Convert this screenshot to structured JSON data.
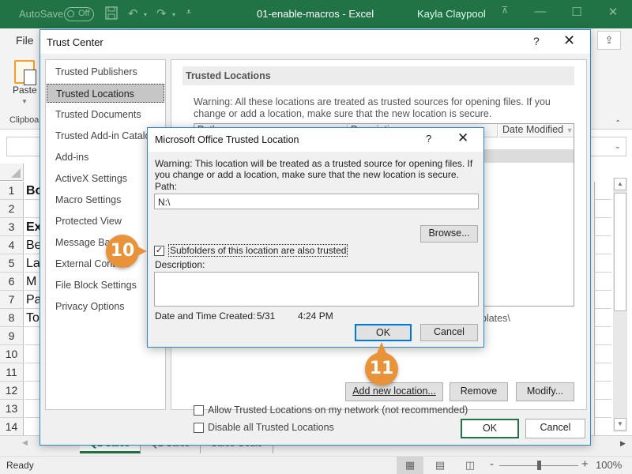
{
  "excel": {
    "autosave_label": "AutoSave",
    "autosave_state": "Off",
    "doc_title": "01-enable-macros  -  Excel",
    "user_name": "Kayla Claypool",
    "file_tab": "File",
    "paste_label": "Paste",
    "clipboard_group": "Clipboa",
    "rows": [
      {
        "num": "1",
        "a": "Bo",
        "bold": true
      },
      {
        "num": "2",
        "a": "",
        "bold": false
      },
      {
        "num": "3",
        "a": "Ex",
        "bold": true
      },
      {
        "num": "4",
        "a": "Be",
        "bold": false
      },
      {
        "num": "5",
        "a": "La",
        "bold": false
      },
      {
        "num": "6",
        "a": "M",
        "bold": false
      },
      {
        "num": "7",
        "a": "Pa",
        "bold": false
      },
      {
        "num": "8",
        "a": "To",
        "bold": false
      },
      {
        "num": "9",
        "a": "",
        "bold": false
      },
      {
        "num": "10",
        "a": "",
        "bold": false
      },
      {
        "num": "11",
        "a": "",
        "bold": false
      },
      {
        "num": "12",
        "a": "",
        "bold": false
      },
      {
        "num": "13",
        "a": "",
        "bold": false
      },
      {
        "num": "14",
        "a": "",
        "bold": false
      }
    ],
    "sheet_tabs": [
      "Q1 Sales",
      "Q2 Sales",
      "Sales Goals"
    ],
    "active_sheet": "Q1 Sales",
    "status": "Ready",
    "zoom_level": "100%"
  },
  "trust_center": {
    "title": "Trust Center",
    "help": "?",
    "nav_items": [
      "Trusted Publishers",
      "Trusted Locations",
      "Trusted Documents",
      "Trusted Add-in Catalogs",
      "Add-ins",
      "ActiveX Settings",
      "Macro Settings",
      "Protected View",
      "Message Bar",
      "External Content",
      "File Block Settings",
      "Privacy Options"
    ],
    "selected_nav": "Trusted Locations",
    "section_title": "Trusted Locations",
    "warning": "Warning: All these locations are treated as trusted sources for opening files.  If you change or add a location, make sure that the new location is secure.",
    "list_columns": [
      "Path",
      "Description",
      "Date Modified"
    ],
    "path_fragment": "plates\\",
    "buttons": {
      "add": "Add new location...",
      "remove": "Remove",
      "modify": "Modify..."
    },
    "allow_network": {
      "label": "Allow Trusted Locations on my network (not recommended)",
      "checked": false
    },
    "disable_all": {
      "label": "Disable all Trusted Locations",
      "checked": false
    },
    "ok": "OK",
    "cancel": "Cancel"
  },
  "trusted_location_dialog": {
    "title": "Microsoft Office Trusted Location",
    "help": "?",
    "warning": "Warning: This location will be treated as a trusted source for opening files. If you change or add a location, make sure that the new location is secure.",
    "path_label": "Path:",
    "path_value": "N:\\",
    "browse": "Browse...",
    "subfolders": {
      "label": "Subfolders of this location are also trusted",
      "checked": true
    },
    "description_label": "Description:",
    "description_value": "",
    "created_label": "Date and Time Created:",
    "created_date": "5/31",
    "created_time": "4:24 PM",
    "ok": "OK",
    "cancel": "Cancel"
  },
  "callouts": [
    "10",
    "11"
  ],
  "colors": {
    "excel_green": "#217346",
    "dialog_border": "#2b88d8",
    "callout": "#e8923a"
  }
}
